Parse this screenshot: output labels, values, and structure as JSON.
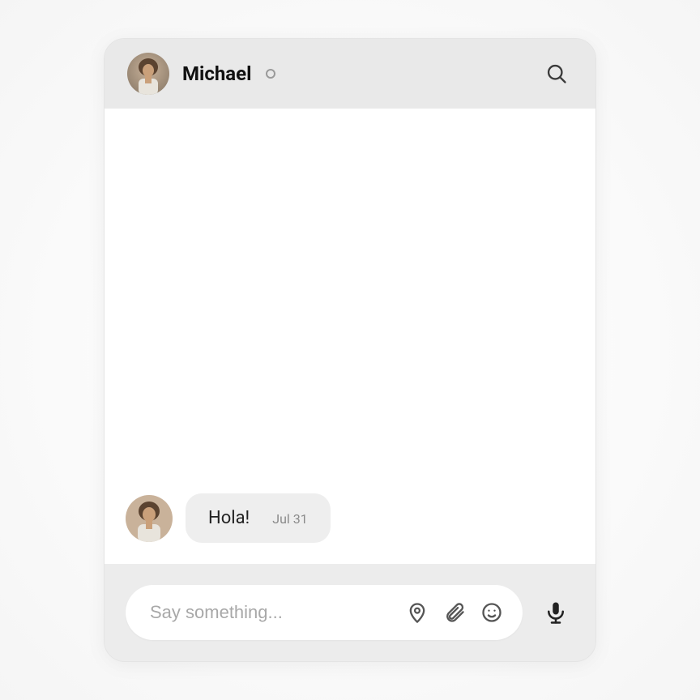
{
  "header": {
    "contact_name": "Michael",
    "status": "offline"
  },
  "messages": [
    {
      "sender": "Michael",
      "text": "Hola!",
      "timestamp": "Jul 31"
    }
  ],
  "composer": {
    "placeholder": "Say something...",
    "value": ""
  },
  "icons": {
    "search": "search-icon",
    "location": "location-pin-icon",
    "attachment": "paperclip-icon",
    "emoji": "smiley-icon",
    "mic": "microphone-icon"
  }
}
